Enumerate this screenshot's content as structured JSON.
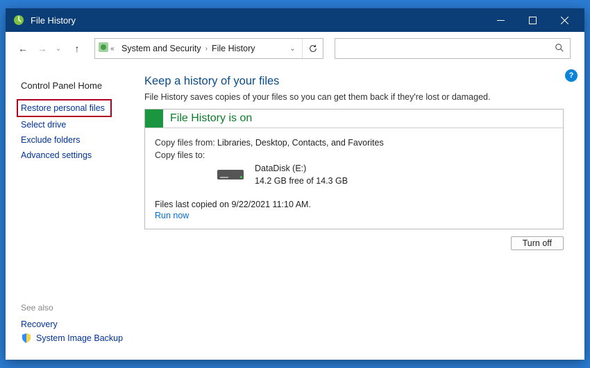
{
  "titlebar": {
    "title": "File History"
  },
  "addressbar": {
    "crumb1": "System and Security",
    "crumb2": "File History"
  },
  "sidebar": {
    "home": "Control Panel Home",
    "links": [
      "Restore personal files",
      "Select drive",
      "Exclude folders",
      "Advanced settings"
    ],
    "seealso_label": "See also",
    "seealso": [
      "Recovery",
      "System Image Backup"
    ]
  },
  "main": {
    "heading": "Keep a history of your files",
    "subtext": "File History saves copies of your files so you can get them back if they're lost or damaged.",
    "status_title": "File History is on",
    "copy_from_label": "Copy files from:",
    "copy_from_value": "Libraries, Desktop, Contacts, and Favorites",
    "copy_to_label": "Copy files to:",
    "drive_name": "DataDisk (E:)",
    "drive_free": "14.2 GB free of 14.3 GB",
    "last_copied": "Files last copied on 9/22/2021 11:10 AM.",
    "run_now": "Run now",
    "turn_off": "Turn off"
  }
}
